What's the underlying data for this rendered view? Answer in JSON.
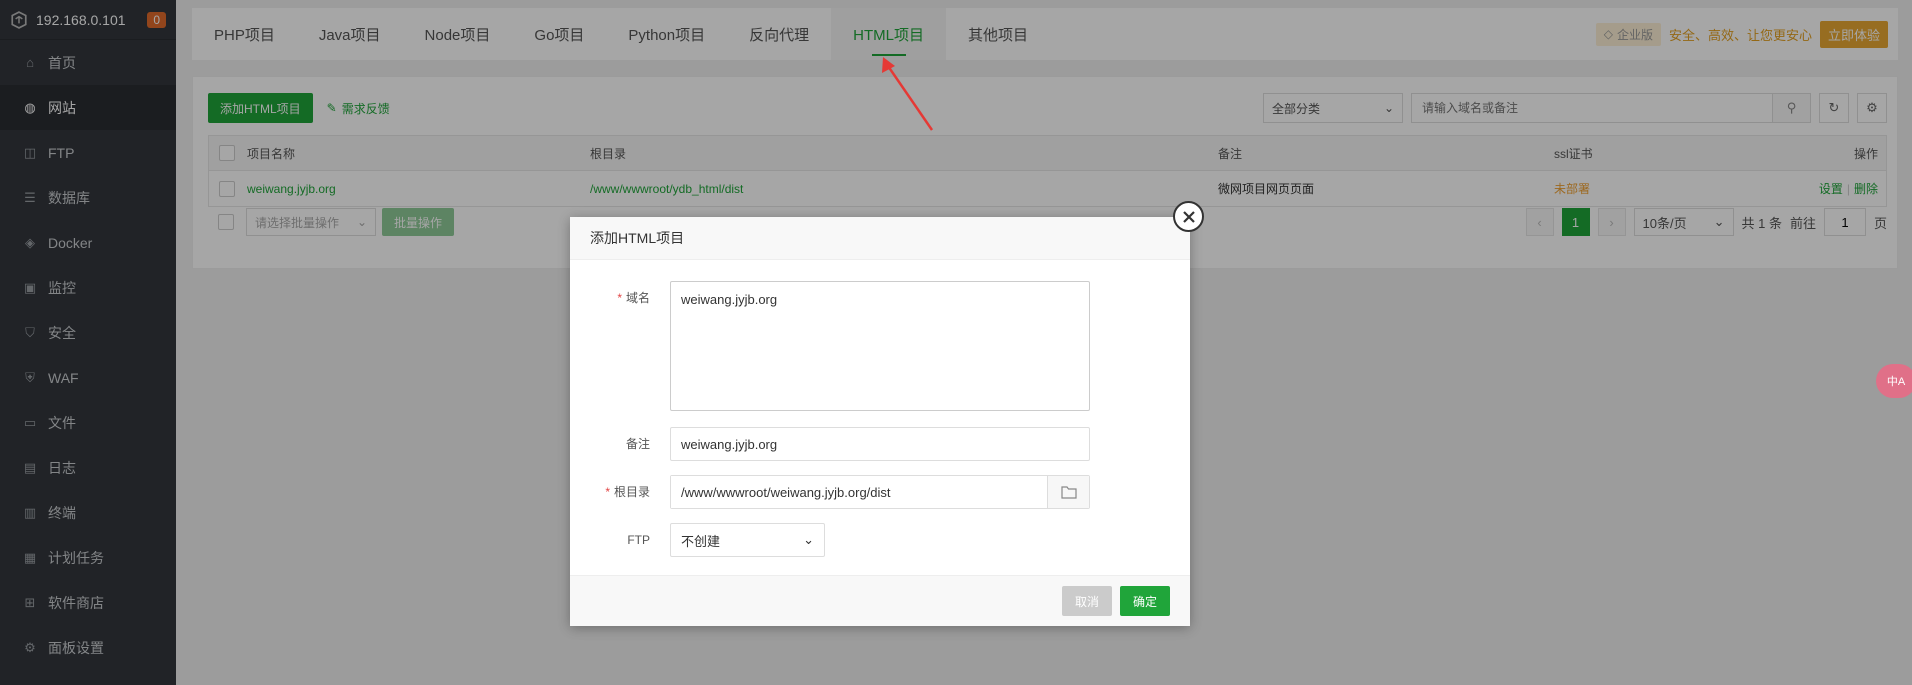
{
  "sidebar": {
    "ip": "192.168.0.101",
    "badge": "0",
    "items": [
      {
        "label": "首页",
        "icon": "home-icon"
      },
      {
        "label": "网站",
        "icon": "globe-icon"
      },
      {
        "label": "FTP",
        "icon": "ftp-icon"
      },
      {
        "label": "数据库",
        "icon": "database-icon"
      },
      {
        "label": "Docker",
        "icon": "docker-icon"
      },
      {
        "label": "监控",
        "icon": "monitor-icon"
      },
      {
        "label": "安全",
        "icon": "shield-icon"
      },
      {
        "label": "WAF",
        "icon": "waf-icon"
      },
      {
        "label": "文件",
        "icon": "folder-icon"
      },
      {
        "label": "日志",
        "icon": "log-icon"
      },
      {
        "label": "终端",
        "icon": "terminal-icon"
      },
      {
        "label": "计划任务",
        "icon": "calendar-icon"
      },
      {
        "label": "软件商店",
        "icon": "grid-icon"
      },
      {
        "label": "面板设置",
        "icon": "settings-icon"
      }
    ]
  },
  "tabs": [
    "PHP项目",
    "Java项目",
    "Node项目",
    "Go项目",
    "Python项目",
    "反向代理",
    "HTML项目",
    "其他项目"
  ],
  "promo": {
    "edition": "企业版",
    "slogan": "安全、高效、让您更安心",
    "try_label": "立即体验"
  },
  "toolbar": {
    "add_label": "添加HTML项目",
    "feedback_label": "需求反馈",
    "category_value": "全部分类",
    "search_placeholder": "请输入域名或备注"
  },
  "table": {
    "headers": {
      "name": "项目名称",
      "path": "根目录",
      "remark": "备注",
      "ssl": "ssl证书",
      "op": "操作"
    },
    "rows": [
      {
        "name": "weiwang.jyjb.org",
        "path": "/www/wwwroot/ydb_html/dist",
        "remark": "微网项目网页页面",
        "ssl": "未部署",
        "op_set": "设置",
        "op_del": "删除"
      }
    ]
  },
  "footer": {
    "batch_placeholder": "请选择批量操作",
    "batch_label": "批量操作",
    "current_page": "1",
    "page_size": "10条/页",
    "total": "共 1 条",
    "goto_prefix": "前往",
    "goto_value": "1",
    "goto_suffix": "页"
  },
  "modal": {
    "title": "添加HTML项目",
    "domain_label": "域名",
    "domain_value": "weiwang.jyjb.org",
    "remark_label": "备注",
    "remark_value": "weiwang.jyjb.org",
    "root_label": "根目录",
    "root_value": "/www/wwwroot/weiwang.jyjb.org/dist",
    "ftp_label": "FTP",
    "ftp_value": "不创建",
    "cancel_label": "取消",
    "ok_label": "确定"
  },
  "translate_label": "中A",
  "colors": {
    "accent": "#20a53a",
    "sidebar_bg": "#33373d",
    "warning": "#f0a030",
    "annotation_arrow": "#e53935"
  }
}
